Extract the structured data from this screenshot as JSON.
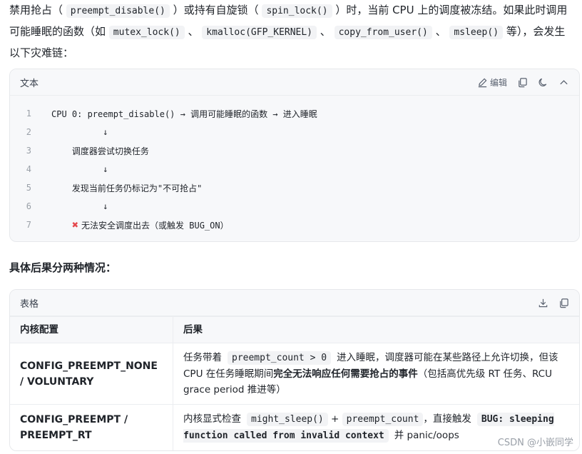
{
  "intro": {
    "p1": "禁用抢占（",
    "c1": "preempt_disable()",
    "p2": "）或持有自旋锁（",
    "c2": "spin_lock()",
    "p3": "）时，当前 CPU 上的调度被冻结。如果此时调用可能睡眠的函数（如",
    "c3": "mutex_lock()",
    "p4": "、",
    "c4": "kmalloc(GFP_KERNEL)",
    "p5": "、",
    "c5": "copy_from_user()",
    "p6": "、",
    "c6": "msleep()",
    "p7": "等），会发生以下灾难链："
  },
  "code_block": {
    "title": "文本",
    "edit_label": "编辑",
    "icons": [
      "edit-icon",
      "copy-icon",
      "moon-icon",
      "chevron-up-icon"
    ],
    "lines": [
      {
        "n": "1",
        "text": "CPU 0: preempt_disable() → 调用可能睡眠的函数 → 进入睡眠"
      },
      {
        "n": "2",
        "text": "          ↓"
      },
      {
        "n": "3",
        "text": "    调度器尝试切换任务"
      },
      {
        "n": "4",
        "text": "          ↓"
      },
      {
        "n": "5",
        "text": "    发现当前任务仍标记为\"不可抢占\""
      },
      {
        "n": "6",
        "text": "          ↓"
      },
      {
        "n": "7",
        "text": "无法安全调度出去（或触发 BUG_ON）"
      }
    ]
  },
  "heading": "具体后果分两种情况：",
  "table": {
    "title": "表格",
    "icons": [
      "download-icon",
      "copy-icon"
    ],
    "headers": [
      "内核配置",
      "后果"
    ],
    "rows": [
      {
        "config": "CONFIG_PREEMPT_NONE / VOLUNTARY",
        "r1a": "任务带着",
        "r1code": "preempt_count > 0",
        "r1b": "进入睡眠，调度器可能在某些路径上允许切换，但该 CPU 在任务睡眠期间",
        "r1bold": "完全无法响应任何需要抢占的事件",
        "r1c": "（包括高优先级 RT 任务、RCU grace period 推进等）"
      },
      {
        "config": "CONFIG_PREEMPT / PREEMPT_RT",
        "r2a": "内核显式检查",
        "r2code1": "might_sleep()",
        "r2plus": "+",
        "r2code2": "preempt_count",
        "r2b": "，直接触发",
        "r2code3": "BUG: sleeping function called from invalid context",
        "r2c": "并 panic/oops"
      }
    ]
  },
  "watermark": "CSDN @小嵌同学",
  "colors": {
    "accent_x": "#e5484d",
    "code_bg": "#f2f3f5",
    "card_bg": "#f7f8fa"
  }
}
